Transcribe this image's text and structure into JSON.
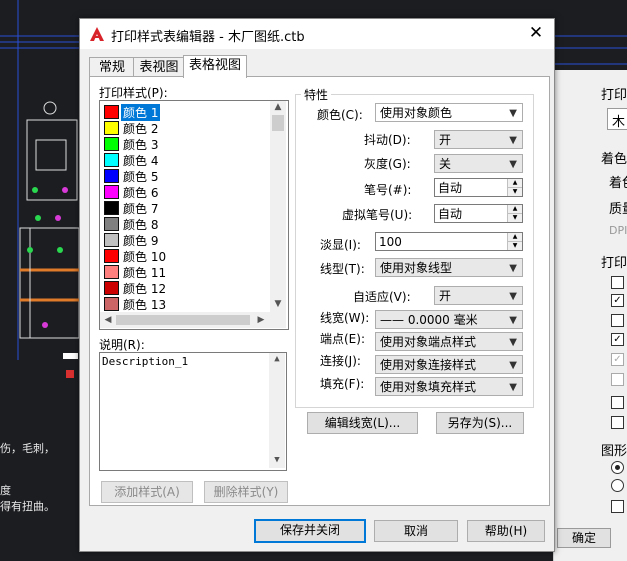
{
  "cad_notes": [
    "伤，毛刺，",
    "度",
    "得有扭曲。"
  ],
  "right_panel": {
    "labels": [
      "打印",
      "木",
      "着色",
      "着色",
      "质量",
      "DPI",
      "打印",
      "图形",
      "确定"
    ]
  },
  "dialog": {
    "title": "打印样式表编辑器 - 木厂图纸.ctb",
    "tabs": [
      "常规",
      "表视图",
      "表格视图"
    ],
    "styles_label": "打印样式(P):",
    "styles": [
      {
        "name": "颜色 1",
        "color": "#ff0000"
      },
      {
        "name": "颜色 2",
        "color": "#ffff00"
      },
      {
        "name": "颜色 3",
        "color": "#00ff00"
      },
      {
        "name": "颜色 4",
        "color": "#00ffff"
      },
      {
        "name": "颜色 5",
        "color": "#0000ff"
      },
      {
        "name": "颜色 6",
        "color": "#ff00ff"
      },
      {
        "name": "颜色 7",
        "color": "#000000"
      },
      {
        "name": "颜色 8",
        "color": "#808080"
      },
      {
        "name": "颜色 9",
        "color": "#c0c0c0"
      },
      {
        "name": "颜色 10",
        "color": "#ff0000"
      },
      {
        "name": "颜色 11",
        "color": "#ff7f7f"
      },
      {
        "name": "颜色 12",
        "color": "#cc0000"
      },
      {
        "name": "颜色 13",
        "color": "#cc6666"
      }
    ],
    "description_label": "说明(R):",
    "description": "Description_1",
    "add_style": "添加样式(A)",
    "delete_style": "删除样式(Y)",
    "props_title": "特性",
    "props": {
      "color_label": "颜色(C):",
      "color_value": "使用对象颜色",
      "dither_label": "抖动(D):",
      "dither_value": "开",
      "gray_label": "灰度(G):",
      "gray_value": "关",
      "pen_label": "笔号(#):",
      "pen_value": "自动",
      "vpen_label": "虚拟笔号(U):",
      "vpen_value": "自动",
      "screen_label": "淡显(I):",
      "screen_value": "100",
      "linetype_label": "线型(T):",
      "linetype_value": "使用对象线型",
      "adaptive_label": "自适应(V):",
      "adaptive_value": "开",
      "lineweight_label": "线宽(W):",
      "lineweight_value": "—— 0.0000 毫米",
      "endstyle_label": "端点(E):",
      "endstyle_value": "使用对象端点样式",
      "joinstyle_label": "连接(J):",
      "joinstyle_value": "使用对象连接样式",
      "fill_label": "填充(F):",
      "fill_value": "使用对象填充样式"
    },
    "edit_lineweights": "编辑线宽(L)...",
    "save_as": "另存为(S)...",
    "save_close": "保存并关闭",
    "cancel": "取消",
    "help": "帮助(H)"
  }
}
